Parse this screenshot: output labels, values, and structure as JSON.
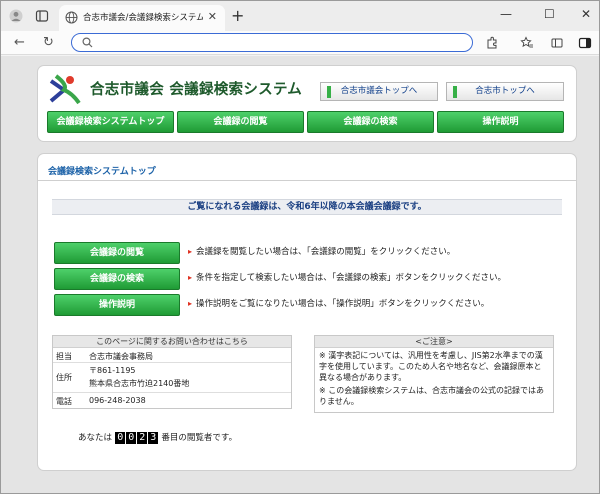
{
  "browser": {
    "tab_title": "合志市議会/会議録検索システム",
    "new_tab": "+",
    "url": "",
    "window_controls": [
      "—",
      "☐",
      "✕"
    ]
  },
  "header": {
    "site_title": "合志市議会 会議録検索システム",
    "top_links": [
      {
        "label": "合志市議会トップへ"
      },
      {
        "label": "合志市トップへ"
      }
    ],
    "menu": [
      {
        "label": "会議録検索システムトップ"
      },
      {
        "label": "会議録の閲覧"
      },
      {
        "label": "会議録の検索"
      },
      {
        "label": "操作説明"
      }
    ]
  },
  "main": {
    "page_title": "会議録検索システムトップ",
    "notice": "ご覧になれる会議録は、令和6年以降の本会議会議録です。",
    "actions": [
      {
        "label": "会議録の閲覧",
        "desc": "会議録を閲覧したい場合は、「会議録の閲覧」をクリックください。"
      },
      {
        "label": "会議録の検索",
        "desc": "条件を指定して検索したい場合は、「会議録の検索」ボタンをクリックください。"
      },
      {
        "label": "操作説明",
        "desc": "操作説明をご覧になりたい場合は、「操作説明」ボタンをクリックください。"
      }
    ],
    "contact": {
      "heading": "このページに関するお問い合わせはこちら",
      "rows": [
        {
          "key": "担当",
          "value": "合志市議会事務局"
        },
        {
          "key": "住所",
          "value": "〒861-1195"
        },
        {
          "key": "",
          "value": "熊本県合志市竹迫2140番地"
        },
        {
          "key": "電話",
          "value": "096-248-2038"
        }
      ]
    },
    "caution": {
      "heading": "<ご注意>",
      "notes": [
        "※ 漢字表記については、汎用性を考慮し、JIS第2水準までの漢字を使用しています。このため人名や地名など、会議録原本と異なる場合があります。",
        "※ この会議録検索システムは、合志市議会の公式の記録ではありません。"
      ]
    },
    "visitor": {
      "prefix": "あなたは",
      "digits": [
        "0",
        "0",
        "2",
        "3"
      ],
      "suffix": "番目の閲覧者です。"
    }
  },
  "colors": {
    "button_green": "#2fb84a",
    "title_blue": "#1c62a8",
    "site_title_green": "#1e5a2c",
    "address_focus": "#3b6bd5"
  }
}
